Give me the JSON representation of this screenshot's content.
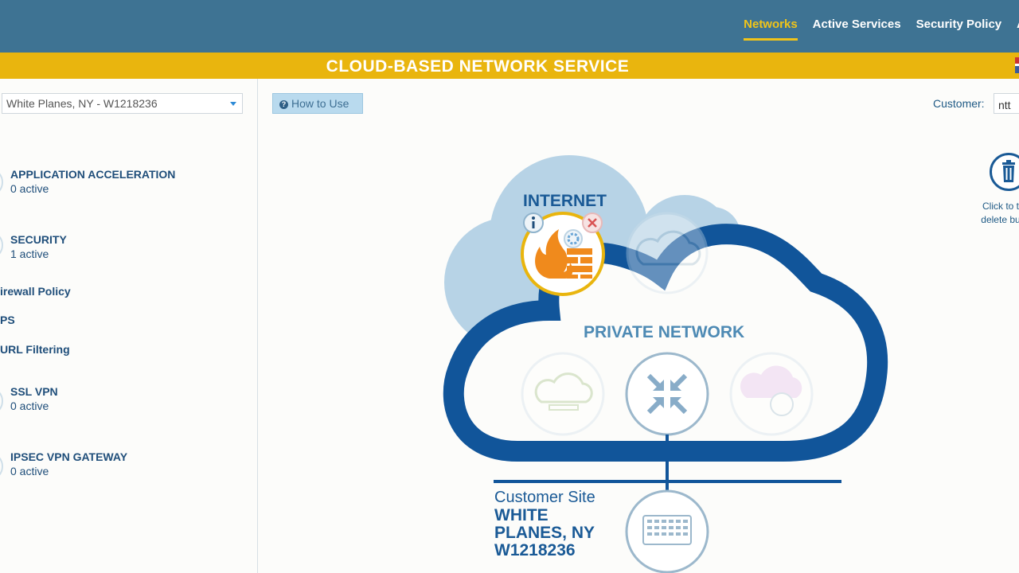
{
  "nav": {
    "items": [
      {
        "label": "Networks",
        "active": true
      },
      {
        "label": "Active Services",
        "active": false
      },
      {
        "label": "Security Policy",
        "active": false
      },
      {
        "label": "A",
        "active": false
      }
    ]
  },
  "banner": {
    "title": "CLOUD-BASED NETWORK SERVICE"
  },
  "sidebar": {
    "site_select": {
      "value": "White Planes, NY - W1218236"
    },
    "services": [
      {
        "title": "APPLICATION ACCELERATION",
        "count": "0 active"
      },
      {
        "title": "SECURITY",
        "count": "1 active"
      },
      {
        "title": "SSL VPN",
        "count": "0 active"
      },
      {
        "title": "IPSEC VPN GATEWAY",
        "count": "0 active"
      }
    ],
    "security_subitems": [
      "irewall Policy",
      "PS",
      "URL Filtering"
    ]
  },
  "toolbar": {
    "how_to_use": "How to Use"
  },
  "customer": {
    "label": "Customer:",
    "value": "ntt"
  },
  "trash": {
    "line1": "Click to t",
    "line2": "delete bu"
  },
  "diagram": {
    "internet_label": "INTERNET",
    "private_label": "PRIVATE NETWORK",
    "customer_site_label": "Customer Site",
    "site_name": "WHITE PLANES, NY W1218236"
  },
  "colors": {
    "nav_bg": "#3e7393",
    "nav_active": "#f0c419",
    "banner_bg": "#e9b50e",
    "cloud_dark": "#11559a",
    "cloud_light": "#b7d3e6",
    "firewall_orange": "#f08a1c"
  }
}
